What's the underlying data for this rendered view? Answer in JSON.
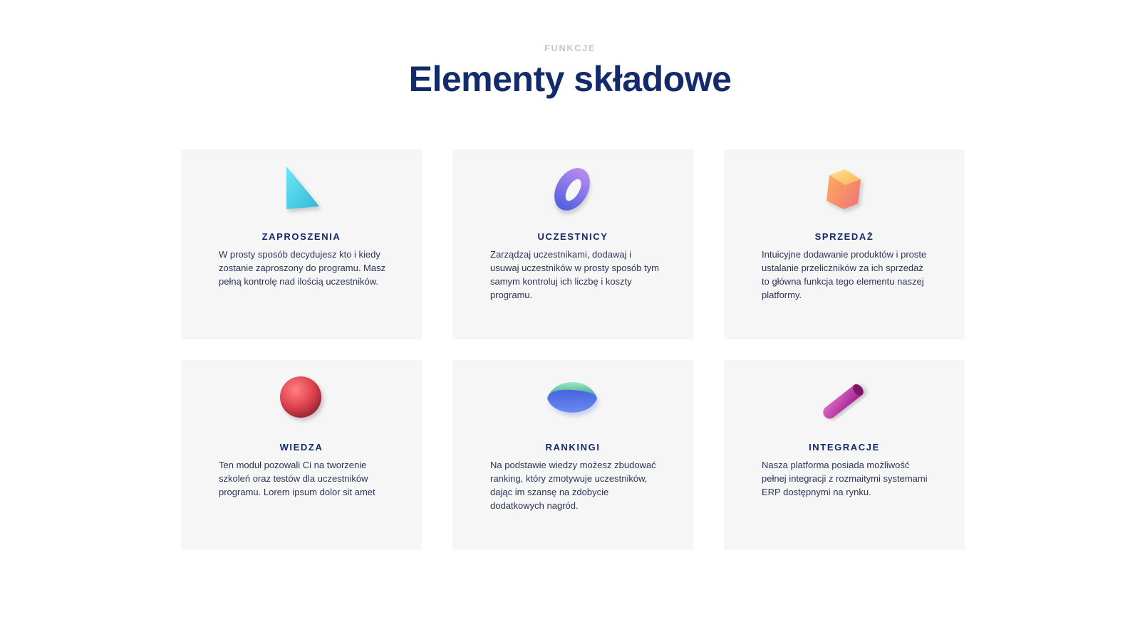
{
  "section": {
    "eyebrow": "FUNKCJE",
    "title": "Elementy składowe"
  },
  "cards": [
    {
      "icon": "triangle-prism-icon",
      "title": "ZAPROSZENIA",
      "text": "W prosty sposób decydujesz kto i kiedy zostanie zaproszony do programu. Masz pełną kontrolę nad ilością uczestników."
    },
    {
      "icon": "torus-icon",
      "title": "UCZESTNICY",
      "text": "Zarządzaj uczestnikami, dodawaj i usuwaj uczestników w prosty sposób tym samym kontroluj ich liczbę i koszty programu."
    },
    {
      "icon": "cube-icon",
      "title": "SPRZEDAŻ",
      "text": "Intuicyjne dodawanie produktów i proste ustalanie przeliczników za ich sprzedaż to główna funkcja tego elementu naszej platformy."
    },
    {
      "icon": "sphere-icon",
      "title": "WIEDZA",
      "text": "Ten moduł pozowali Ci na tworzenie szkoleń oraz testów dla uczestników programu. Lorem ipsum dolor sit amet"
    },
    {
      "icon": "hemisphere-icon",
      "title": "RANKINGI",
      "text": "Na podstawie wiedzy możesz zbudować ranking, który zmotywuje uczestników, dając im szansę na zdobycie dodatkowych nagród."
    },
    {
      "icon": "cylinder-icon",
      "title": "INTEGRACJE",
      "text": "Nasza platforma posiada możliwość pełnej integracji z rozmaitymi systemami ERP dostępnymi na rynku."
    }
  ],
  "colors": {
    "title": "#132b6b",
    "eyebrow": "#c4c8cf",
    "card_bg": "#f6f6f6",
    "text": "#2b3559"
  }
}
